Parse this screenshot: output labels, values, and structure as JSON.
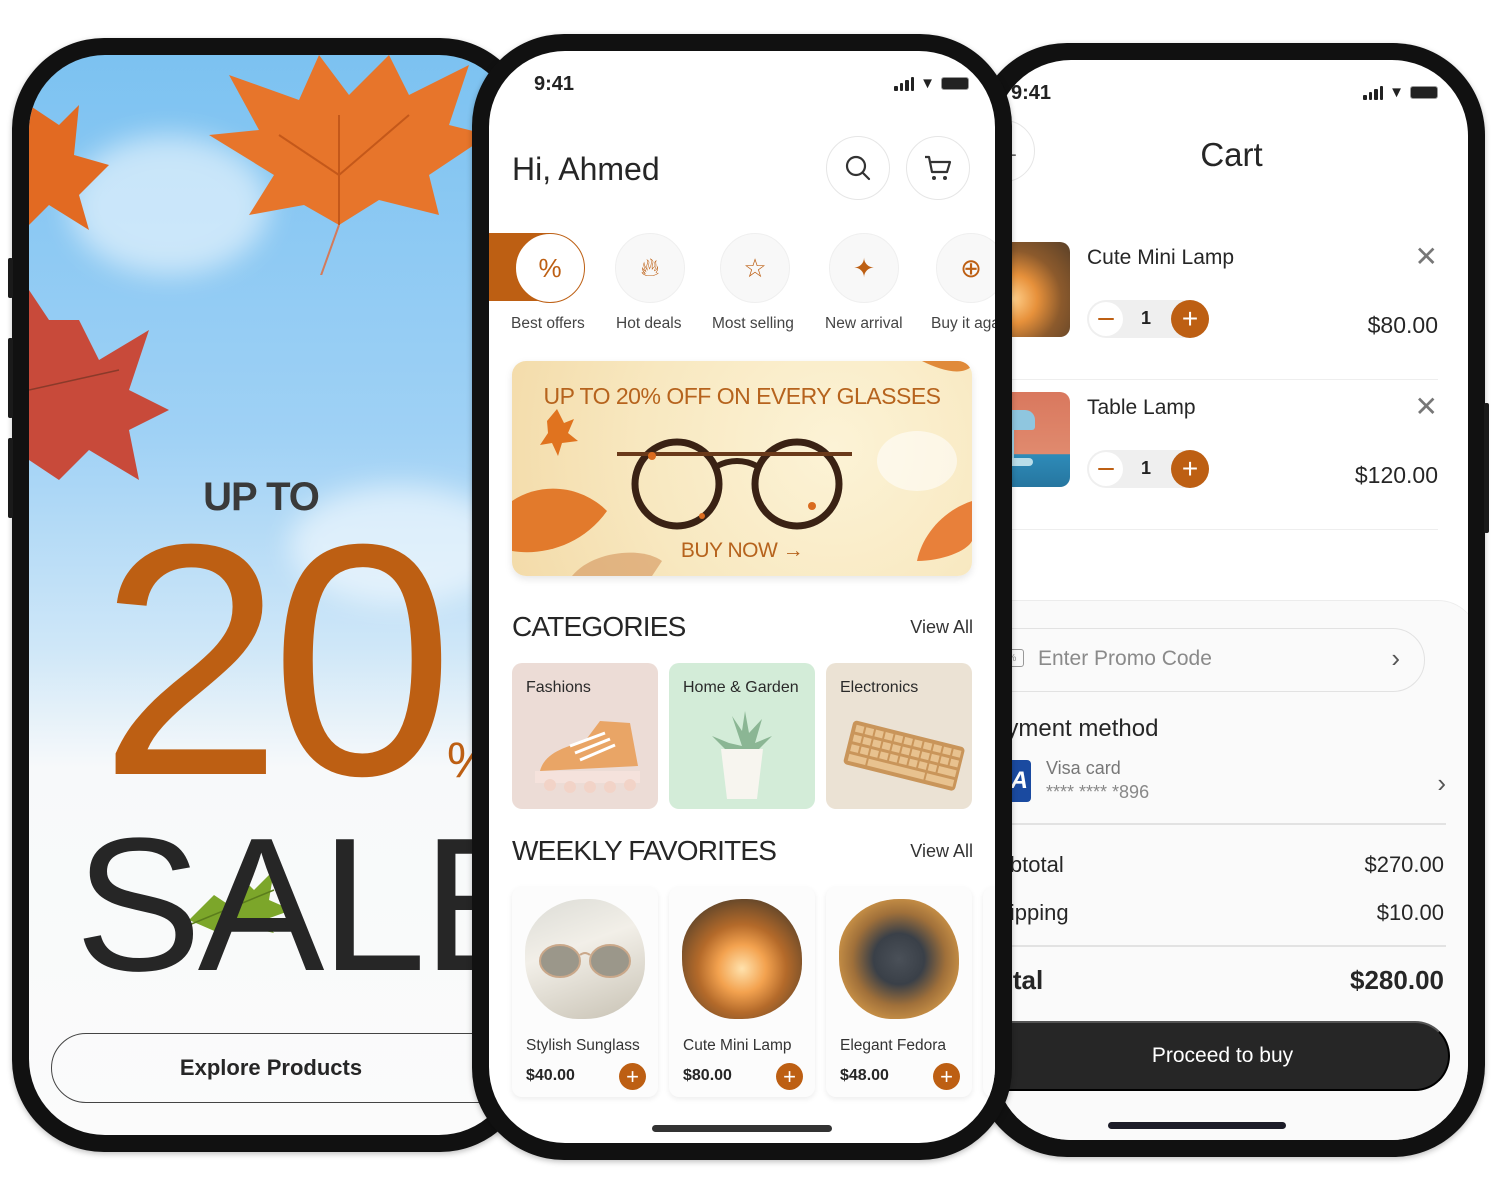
{
  "colors": {
    "accent": "#bd5f13",
    "dark": "#262626",
    "visa_blue": "#1a4aa0"
  },
  "promo_screen": {
    "headline_top": "UP TO",
    "discount_number": "20",
    "percent_sign": "%",
    "headline_bottom": "SALE",
    "explore_button": "Explore Products"
  },
  "home_screen": {
    "status_time": "9:41",
    "greeting": "Hi, Ahmed",
    "header_icons": [
      "search-icon",
      "cart-icon"
    ],
    "quick_categories": [
      {
        "label": "Best offers",
        "icon": "percent-icon",
        "active": true
      },
      {
        "label": "Hot deals",
        "icon": "flame-icon",
        "active": false
      },
      {
        "label": "Most selling",
        "icon": "star-icon",
        "active": false
      },
      {
        "label": "New arrival",
        "icon": "sparkle-icon",
        "active": false
      },
      {
        "label": "Buy it again",
        "icon": "add-circle-icon",
        "active": false
      }
    ],
    "banner": {
      "title": "UP TO 20% OFF ON EVERY GLASSES",
      "cta": "BUY NOW →"
    },
    "categories": {
      "title": "CATEGORIES",
      "view_all": "View All",
      "items": [
        {
          "label": "Fashions",
          "bg": "#ecdcd6"
        },
        {
          "label": "Home & Garden",
          "bg": "#d3ecd8"
        },
        {
          "label": "Electronics",
          "bg": "#ebe2d4"
        }
      ]
    },
    "weekly_favorites": {
      "title": "WEEKLY FAVORITES",
      "view_all": "View All",
      "items": [
        {
          "name": "Stylish Sunglass",
          "price": "$40.00"
        },
        {
          "name": "Cute Mini Lamp",
          "price": "$80.00"
        },
        {
          "name": "Elegant Fedora",
          "price": "$48.00"
        }
      ]
    }
  },
  "cart_screen": {
    "status_time": "9:41",
    "title": "Cart",
    "items": [
      {
        "name": "Cute Mini Lamp",
        "quantity": "1",
        "price": "$80.00"
      },
      {
        "name": "Table Lamp",
        "quantity": "1",
        "price": "$120.00"
      }
    ],
    "promo_placeholder": "Enter Promo Code",
    "payment_title": "Payment method",
    "payment_card": {
      "brand": "VISA",
      "name": "Visa card",
      "number": "**** **** *896"
    },
    "summary": {
      "subtotal_label": "Subtotal",
      "subtotal": "$270.00",
      "shipping_label": "Shipping",
      "shipping": "$10.00",
      "total_label": "Total",
      "total": "$280.00"
    },
    "proceed_button": "Proceed to buy"
  }
}
